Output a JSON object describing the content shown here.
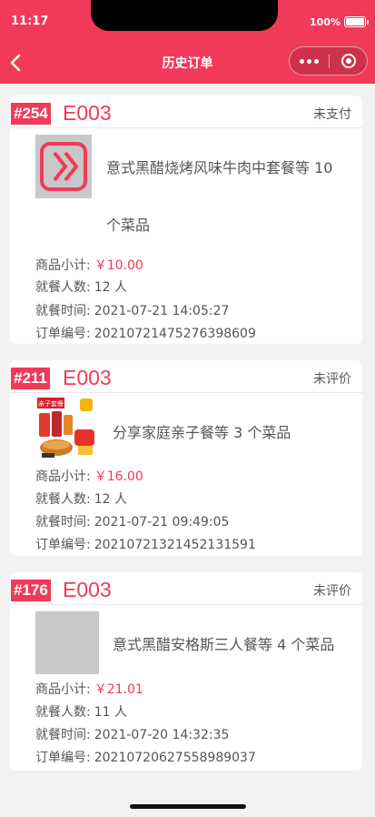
{
  "status_bar": {
    "time": "11:17",
    "battery_percent": "100%"
  },
  "nav": {
    "title": "历史订单"
  },
  "labels": {
    "subtotal": "商品小计:",
    "people": "就餐人数:",
    "dine_time": "就餐时间:",
    "order_no": "订单编号:"
  },
  "orders": [
    {
      "table_no": "#254",
      "table_code": "E003",
      "status": "未支付",
      "title_line1": "意式黑醋烧烤风味牛肉中套餐等 10",
      "title_line2": "个菜品",
      "thumb_icon": "restaurant-logo-icon",
      "subtotal": "￥10.00",
      "people": "12 人",
      "dine_time": "2021-07-21 14:05:27",
      "order_no": "20210721475276398609"
    },
    {
      "table_no": "#211",
      "table_code": "E003",
      "status": "未评价",
      "title_line1": "分享家庭亲子餐等 3 个菜品",
      "thumb_icon": "family-meal-photo",
      "thumb_text": "亲子套餐",
      "subtotal": "￥16.00",
      "people": "12 人",
      "dine_time": "2021-07-21 09:49:05",
      "order_no": "20210721321452131591"
    },
    {
      "table_no": "#176",
      "table_code": "E003",
      "status": "未评价",
      "title_line1": "意式黑醋安格斯三人餐等 4 个菜品",
      "thumb_icon": "image-placeholder",
      "subtotal": "￥21.01",
      "people": "11 人",
      "dine_time": "2021-07-20 14:32:35",
      "order_no": "20210720627558989037"
    }
  ],
  "colors": {
    "brand": "#f13a59",
    "background": "#f2f2f2",
    "card": "#ffffff",
    "text": "#555555"
  }
}
